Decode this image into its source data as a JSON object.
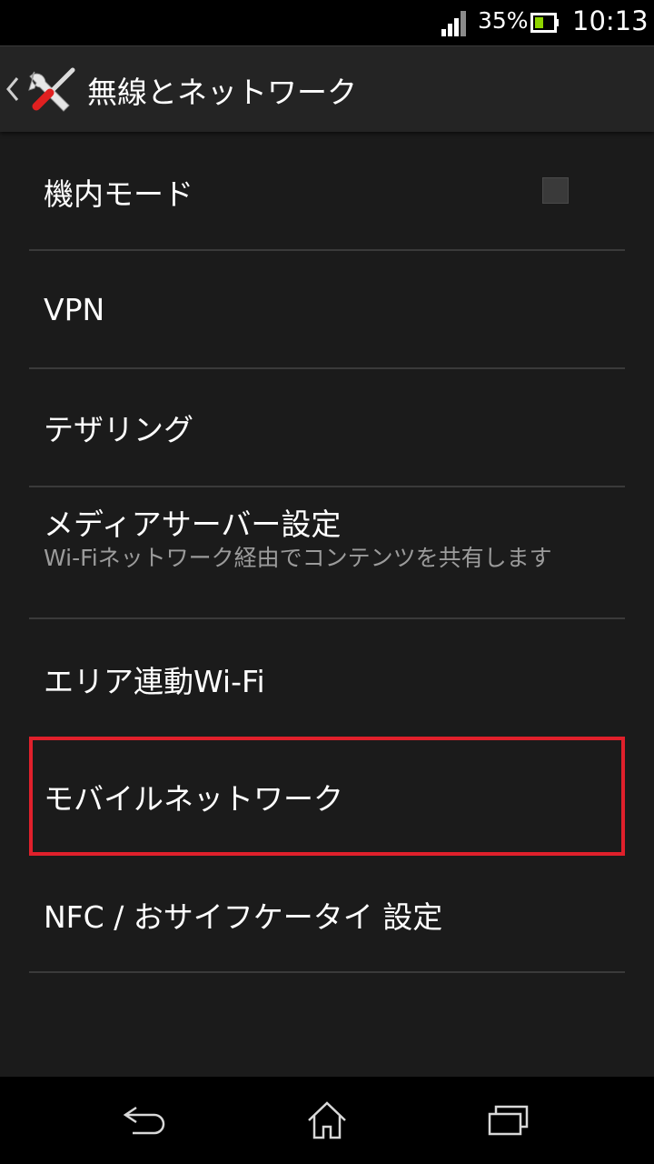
{
  "status_bar": {
    "battery_percent": "35%",
    "time": "10:13",
    "icons": [
      "signal-icon",
      "battery-icon"
    ]
  },
  "action_bar": {
    "title": "無線とネットワーク",
    "icons": [
      "back-chevron-icon",
      "settings-tools-icon"
    ]
  },
  "settings": [
    {
      "title": "機内モード",
      "checkbox": true,
      "checked": false
    },
    {
      "title": "VPN"
    },
    {
      "title": "テザリング"
    },
    {
      "title": "メディアサーバー設定",
      "summary": "Wi-Fiネットワーク経由でコンテンツを共有します"
    },
    {
      "title": "エリア連動Wi-Fi"
    },
    {
      "title": "モバイルネットワーク",
      "highlighted": true
    },
    {
      "title": "NFC / おサイフケータイ 設定"
    }
  ],
  "highlight_color": "#e0202b",
  "nav_bar": {
    "icons": [
      "back-icon",
      "home-icon",
      "recent-apps-icon"
    ]
  }
}
